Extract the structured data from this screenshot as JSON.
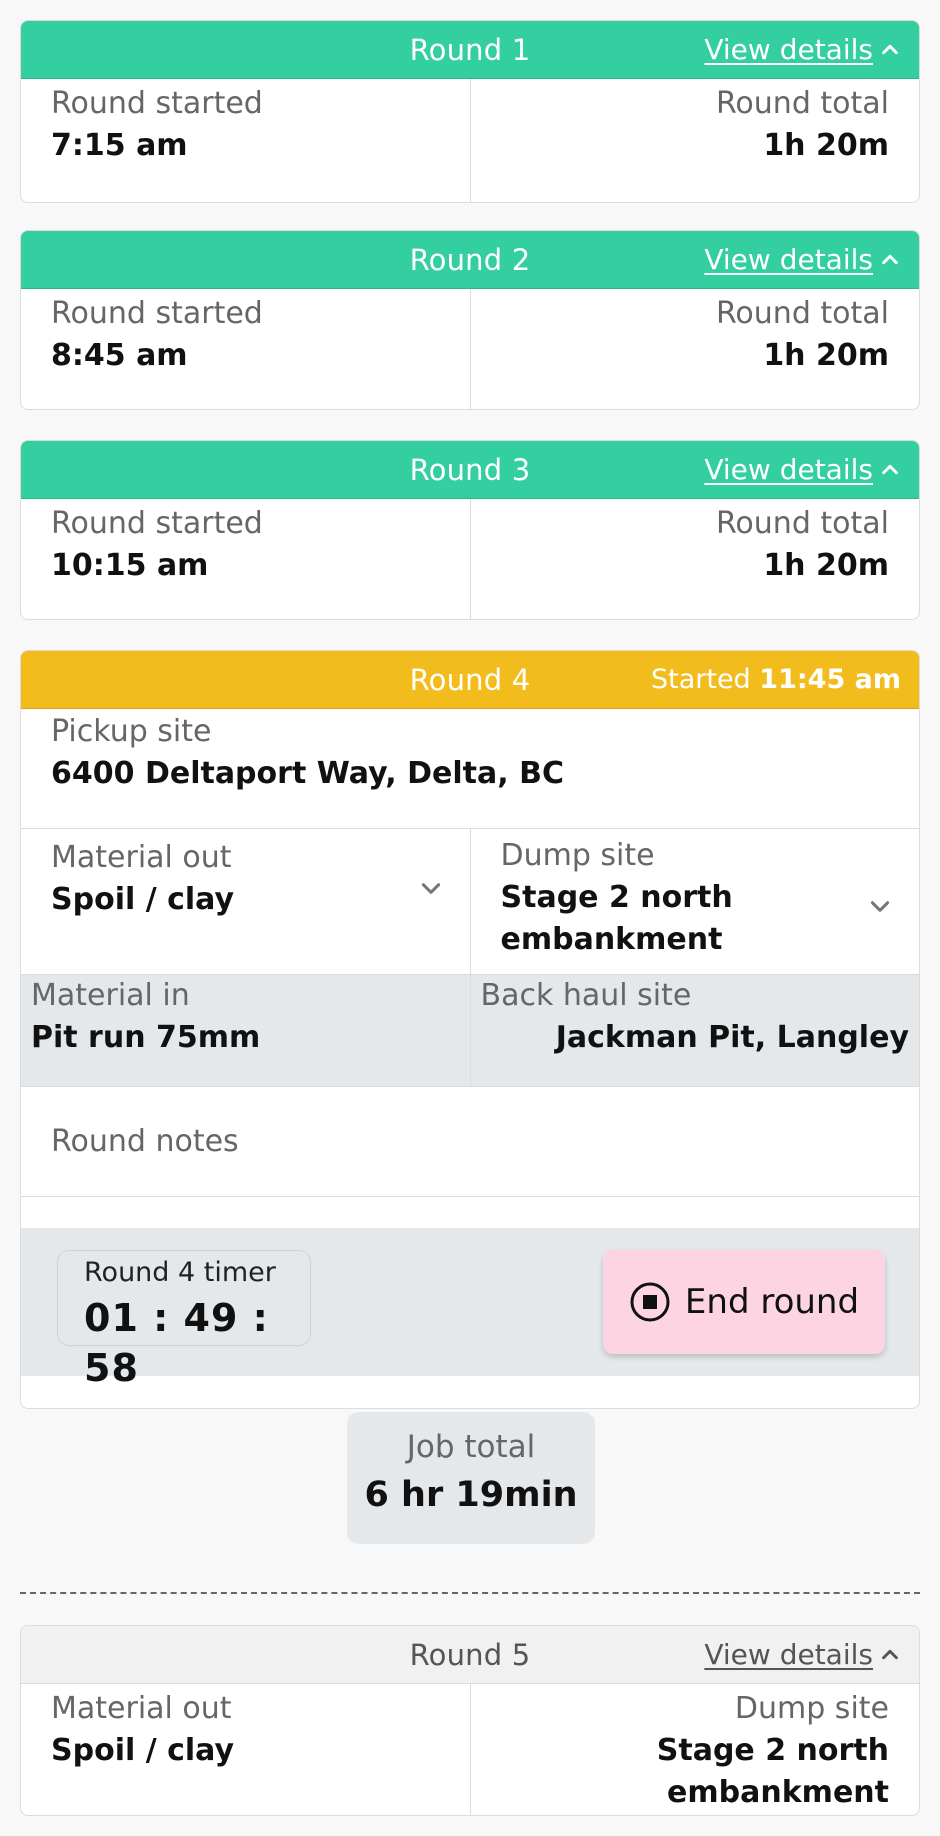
{
  "rounds_completed": [
    {
      "title": "Round 1",
      "link": "View details",
      "started_label": "Round started",
      "started": "7:15 am",
      "total_label": "Round total",
      "total": "1h 20m"
    },
    {
      "title": "Round 2",
      "link": "View details",
      "started_label": "Round started",
      "started": "8:45 am",
      "total_label": "Round total",
      "total": "1h 20m"
    },
    {
      "title": "Round 3",
      "link": "View details",
      "started_label": "Round started",
      "started": "10:15 am",
      "total_label": "Round total",
      "total": "1h 20m"
    }
  ],
  "round4": {
    "title": "Round 4",
    "started_prefix": "Started",
    "started_time": "11:45 am",
    "pickup_label": "Pickup site",
    "pickup_value": "6400 Deltaport Way, Delta, BC",
    "material_out_label": "Material out",
    "material_out_value": "Spoil / clay",
    "dump_label": "Dump site",
    "dump_value_line1": "Stage 2 north",
    "dump_value_line2": "embankment",
    "material_in_label": "Material in",
    "material_in_value": "Pit run 75mm",
    "backhaul_label": "Back haul site",
    "backhaul_value": "Jackman Pit, Langley",
    "notes_placeholder": "Round notes",
    "timer_label": "Round 4 timer",
    "timer_value": "01 : 49 : 58",
    "end_button": "End round"
  },
  "job_total": {
    "label": "Job total",
    "value": "6 hr 19min"
  },
  "round5": {
    "title": "Round 5",
    "link": "View details",
    "material_out_label": "Material out",
    "material_out_value": "Spoil / clay",
    "dump_label": "Dump site",
    "dump_value_line1": "Stage 2 north",
    "dump_value_line2": "embankment"
  },
  "icons": {
    "view_details": "chevron-up-icon",
    "dropdown": "chevron-down-icon",
    "end_round": "stop-circle-icon"
  },
  "colors": {
    "completed_header": "#33cfa0",
    "active_header": "#f2bd1c",
    "upcoming_header": "#f1f1f1",
    "end_button_bg": "#fdd5e2"
  }
}
